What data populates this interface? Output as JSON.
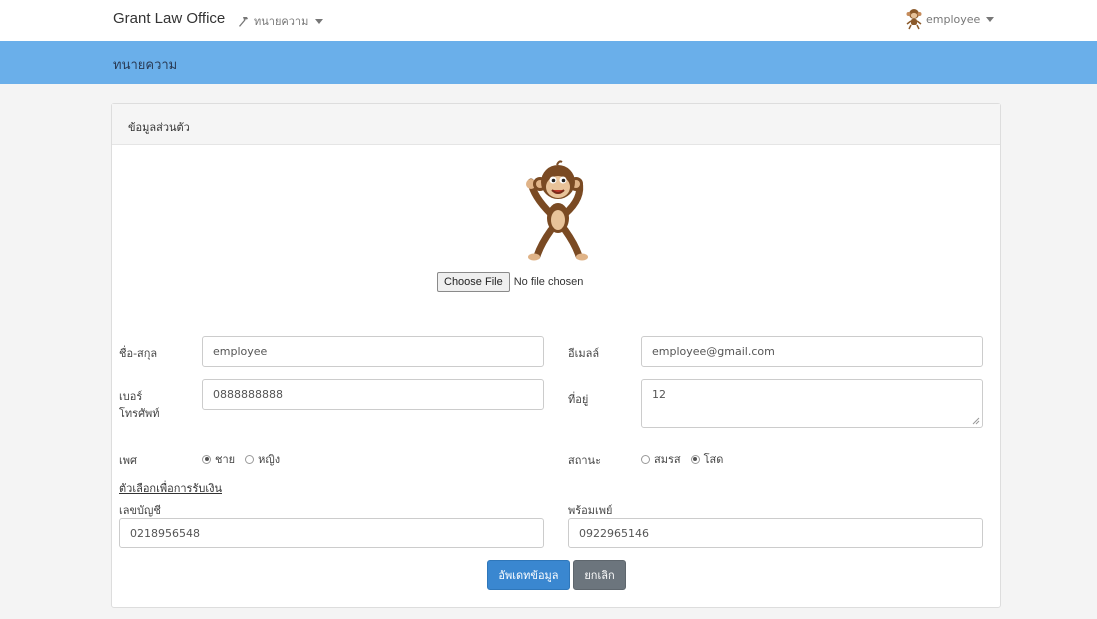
{
  "navbar": {
    "brand": "Grant Law Office",
    "menu_label": "ทนายความ",
    "user_label": "employee"
  },
  "banner": {
    "title": "ทนายความ"
  },
  "panel": {
    "title": "ข้อมูลส่วนตัว",
    "file_button": "Choose File",
    "file_status": "No file chosen"
  },
  "form": {
    "fullname_label": "ชื่อ-สกุล",
    "fullname_value": "employee",
    "email_label": "อีเมลล์",
    "email_value": "employee@gmail.com",
    "phone_label_1": "เบอร์",
    "phone_label_2": "โทรศัพท์",
    "phone_value": "0888888888",
    "address_label": "ที่อยู่",
    "address_value": "12",
    "gender_label": "เพศ",
    "gender_options": [
      "ชาย",
      "หญิง"
    ],
    "gender_selected": "ชาย",
    "status_label": "สถานะ",
    "status_options": [
      "สมรส",
      "โสด"
    ],
    "status_selected": "โสด",
    "payment_link": "ตัวเลือกเพื่อการรับเงิน",
    "account_label": "เลขบัญชี",
    "account_value": "0218956548",
    "promptpay_label": "พร้อมเพย์",
    "promptpay_value": "0922965146",
    "update_button": "อัพเดทข้อมูล",
    "cancel_button": "ยกเลิก"
  },
  "icons": {
    "menu_icon": "hammer-icon",
    "dropdown_icon": "caret-down-icon",
    "avatar": "monkey-avatar"
  },
  "colors": {
    "banner": "#6aafea",
    "primary_button": "#3a87d0",
    "cancel_button": "#6c757d"
  }
}
